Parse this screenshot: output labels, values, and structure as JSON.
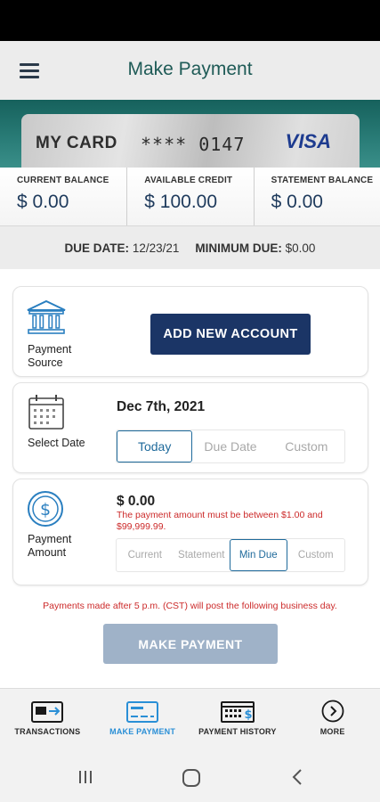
{
  "header": {
    "title": "Make Payment",
    "menu_icon": "hamburger-menu-icon"
  },
  "card": {
    "name": "MY CARD",
    "number": "**** 0147",
    "brand": "VISA"
  },
  "balances": [
    {
      "label": "CURRENT BALANCE",
      "value": "$ 0.00"
    },
    {
      "label": "AVAILABLE CREDIT",
      "value": "$ 100.00"
    },
    {
      "label": "STATEMENT BALANCE",
      "value": "$ 0.00"
    }
  ],
  "due": {
    "due_date_label": "DUE DATE:",
    "due_date_value": "12/23/21",
    "minimum_due_label": "MINIMUM DUE:",
    "minimum_due_value": "$0.00"
  },
  "payment_source": {
    "label": "Payment Source",
    "icon": "bank-icon",
    "button_label": "ADD NEW ACCOUNT"
  },
  "select_date": {
    "label": "Select Date",
    "icon": "calendar-icon",
    "value": "Dec 7th, 2021",
    "options": [
      "Today",
      "Due Date",
      "Custom"
    ],
    "selected": "Today"
  },
  "payment_amount": {
    "label": "Payment Amount",
    "icon": "dollar-circle-icon",
    "value": "$  0.00",
    "error": "The payment amount must be between $1.00 and $99,999.99.",
    "options": [
      "Current",
      "Statement",
      "Min Due",
      "Custom"
    ],
    "selected": "Min Due"
  },
  "notice": "Payments made after 5 p.m. (CST) will post the following business day.",
  "submit_label": "MAKE PAYMENT",
  "bottom_nav": [
    {
      "label": "TRANSACTIONS",
      "icon": "card-transfer-icon",
      "active": false
    },
    {
      "label": "MAKE PAYMENT",
      "icon": "card-payment-icon",
      "active": true
    },
    {
      "label": "PAYMENT HISTORY",
      "icon": "payment-history-icon",
      "active": false
    },
    {
      "label": "MORE",
      "icon": "more-chevron-icon",
      "active": false
    }
  ],
  "colors": {
    "brand_teal": "#1f5b57",
    "primary_button": "#1b3566",
    "disabled_button": "#9fb2c8",
    "error": "#cc2a2a",
    "active_nav": "#2a8fd6",
    "segment_active": "#1f6a9b"
  }
}
